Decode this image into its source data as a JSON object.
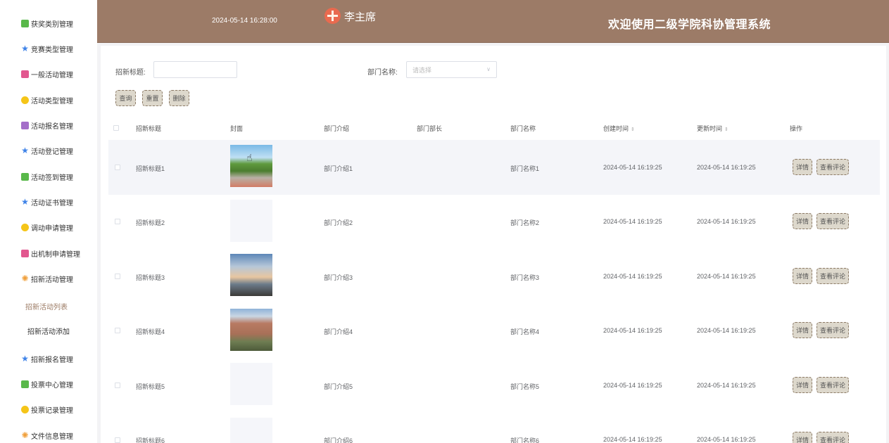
{
  "sidebar": {
    "items": [
      {
        "label": "获奖类别管理",
        "icon": "chat-icon"
      },
      {
        "label": "竞赛类型管理",
        "icon": "star-icon"
      },
      {
        "label": "一般活动管理",
        "icon": "doc-icon"
      },
      {
        "label": "活动类型管理",
        "icon": "hexagon-icon"
      },
      {
        "label": "活动报名管理",
        "icon": "box-icon"
      },
      {
        "label": "活动登记管理",
        "icon": "star-icon"
      },
      {
        "label": "活动签到管理",
        "icon": "chat-icon"
      },
      {
        "label": "活动证书管理",
        "icon": "star-icon"
      },
      {
        "label": "调动申请管理",
        "icon": "hexagon-icon"
      },
      {
        "label": "出机制申请管理",
        "icon": "doc-icon"
      },
      {
        "label": "招新活动管理",
        "icon": "gear-icon"
      },
      {
        "label": "招新报名管理",
        "icon": "star-icon"
      },
      {
        "label": "投票中心管理",
        "icon": "chat-icon"
      },
      {
        "label": "投票记录管理",
        "icon": "hexagon-icon"
      },
      {
        "label": "文件信息管理",
        "icon": "gear-icon"
      }
    ],
    "subitems": [
      {
        "label": "招新活动列表",
        "active": true
      },
      {
        "label": "招新活动添加",
        "active": false
      }
    ]
  },
  "header": {
    "time": "2024-05-14 16:28:00",
    "user": "李主席",
    "title": "欢迎使用二级学院科协管理系统"
  },
  "filters": {
    "title_label": "招新标题:",
    "title_value": "",
    "dept_label": "部门名称:",
    "dept_placeholder": "请选择"
  },
  "buttons": {
    "query": "查询",
    "reset": "重置",
    "delete": "删除"
  },
  "table": {
    "headers": {
      "title": "招新标题",
      "cover": "封面",
      "intro": "部门介绍",
      "head": "部门部长",
      "dept": "部门名称",
      "created": "创建时间",
      "updated": "更新时间",
      "ops": "操作"
    },
    "rows": [
      {
        "title": "招新标题1",
        "cover": "street-photo",
        "intro": "部门介绍1",
        "head": "",
        "dept": "部门名称1",
        "created": "2024-05-14 16:19:25",
        "updated": "2024-05-14 16:19:25"
      },
      {
        "title": "招新标题2",
        "cover": "blank",
        "intro": "部门介绍2",
        "head": "",
        "dept": "部门名称2",
        "created": "2024-05-14 16:19:25",
        "updated": "2024-05-14 16:19:25"
      },
      {
        "title": "招新标题3",
        "cover": "sky-photo",
        "intro": "部门介绍3",
        "head": "",
        "dept": "部门名称3",
        "created": "2024-05-14 16:19:25",
        "updated": "2024-05-14 16:19:25"
      },
      {
        "title": "招新标题4",
        "cover": "campus-photo",
        "intro": "部门介绍4",
        "head": "",
        "dept": "部门名称4",
        "created": "2024-05-14 16:19:25",
        "updated": "2024-05-14 16:19:25"
      },
      {
        "title": "招新标题5",
        "cover": "blank",
        "intro": "部门介绍5",
        "head": "",
        "dept": "部门名称5",
        "created": "2024-05-14 16:19:25",
        "updated": "2024-05-14 16:19:25"
      },
      {
        "title": "招新标题6",
        "cover": "blank",
        "intro": "部门介绍6",
        "head": "",
        "dept": "部门名称6",
        "created": "2024-05-14 16:19:25",
        "updated": "2024-05-14 16:19:25"
      }
    ],
    "row_actions": {
      "detail": "详情",
      "comments": "查看评论"
    }
  },
  "colors": {
    "header_bg": "#9c7b67",
    "button_bg": "#ddd8cc",
    "active_sub": "#9b7a63"
  }
}
